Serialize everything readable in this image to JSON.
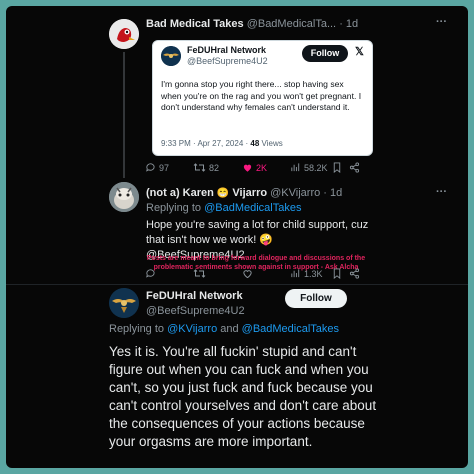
{
  "tweet1": {
    "author_name": "Bad Medical Takes",
    "author_handle": "@BadMedicalTa...",
    "time": "· 1d",
    "more": "···"
  },
  "quote": {
    "author_name": "FeDUHral Network",
    "author_handle": "@BeefSupreme4U2",
    "follow_label": "Follow",
    "text": "I'm gonna stop you right there... stop having sex when you're on the rag and you won't get pregnant. I don't understand why females can't understand it.",
    "meta": "9:33 PM · Apr 27, 2024 · ",
    "views_count": "48",
    "views_label": " Views"
  },
  "tweet1_actions": {
    "replies": "97",
    "retweets": "82",
    "likes": "2K",
    "views": "58.2K"
  },
  "tweet2": {
    "author_name": "(not a) Karen",
    "emoji": "😁",
    "author_name2": "Vijarro",
    "author_handle": "@KVijarro",
    "time": "· 1d",
    "more": "···",
    "replying_prefix": "Replying to ",
    "replying_to": "@BadMedicalTakes",
    "text_line1": "Hope you're saving a lot for child support, cuz",
    "text_line2": "that isn't how we work! 🤪",
    "mention": "@BeefSupreme4U2"
  },
  "overlay": {
    "line1": "Posts are meant to bring forward dialogue and discussions of the",
    "line2": "problematic sentiments shown against in support - Ask Alcha"
  },
  "tweet2_actions": {
    "views": "1.3K"
  },
  "tweet3": {
    "author_name": "FeDUHral Network",
    "author_handle": "@BeefSupreme4U2",
    "follow_label": "Follow",
    "replying_prefix": "Replying to ",
    "replying_to1": "@KVijarro",
    "replying_and": " and ",
    "replying_to2": "@BadMedicalTakes",
    "text": "Yes it is. You're all fuckin' stupid and can't figure out when you can fuck and when you can't, so you just fuck and fuck because you can't control yourselves and don't care about the consequences of your actions because your orgasms are more important."
  },
  "colors": {
    "accent": "#1d9bf0",
    "like": "#f91880",
    "background": "#5aa6a2"
  }
}
